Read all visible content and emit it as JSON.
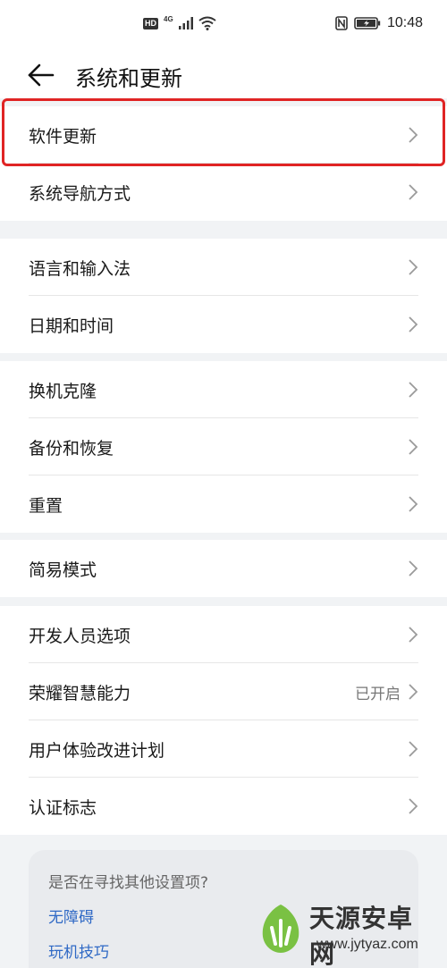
{
  "status_bar": {
    "hd_label": "HD",
    "network_label": "4G",
    "nfc_label": "N",
    "time": "10:48"
  },
  "header": {
    "title": "系统和更新",
    "back_icon": "arrow-left-icon"
  },
  "groups": [
    {
      "items": [
        {
          "label": "软件更新"
        },
        {
          "label": "系统导航方式"
        }
      ]
    },
    {
      "items": [
        {
          "label": "语言和输入法"
        },
        {
          "label": "日期和时间"
        }
      ]
    },
    {
      "items": [
        {
          "label": "换机克隆"
        },
        {
          "label": "备份和恢复"
        },
        {
          "label": "重置"
        }
      ]
    },
    {
      "items": [
        {
          "label": "简易模式"
        }
      ]
    },
    {
      "items": [
        {
          "label": "开发人员选项"
        },
        {
          "label": "荣耀智慧能力",
          "value": "已开启"
        },
        {
          "label": "用户体验改进计划"
        },
        {
          "label": "认证标志"
        }
      ]
    }
  ],
  "search_suggestions": {
    "question": "是否在寻找其他设置项?",
    "links": [
      "无障碍",
      "玩机技巧"
    ]
  },
  "watermark": {
    "text": "天源安卓网",
    "url": "www.jytyaz.com"
  },
  "colors": {
    "highlight": "#e02424",
    "link": "#2f69c5",
    "background": "#f1f3f5"
  }
}
